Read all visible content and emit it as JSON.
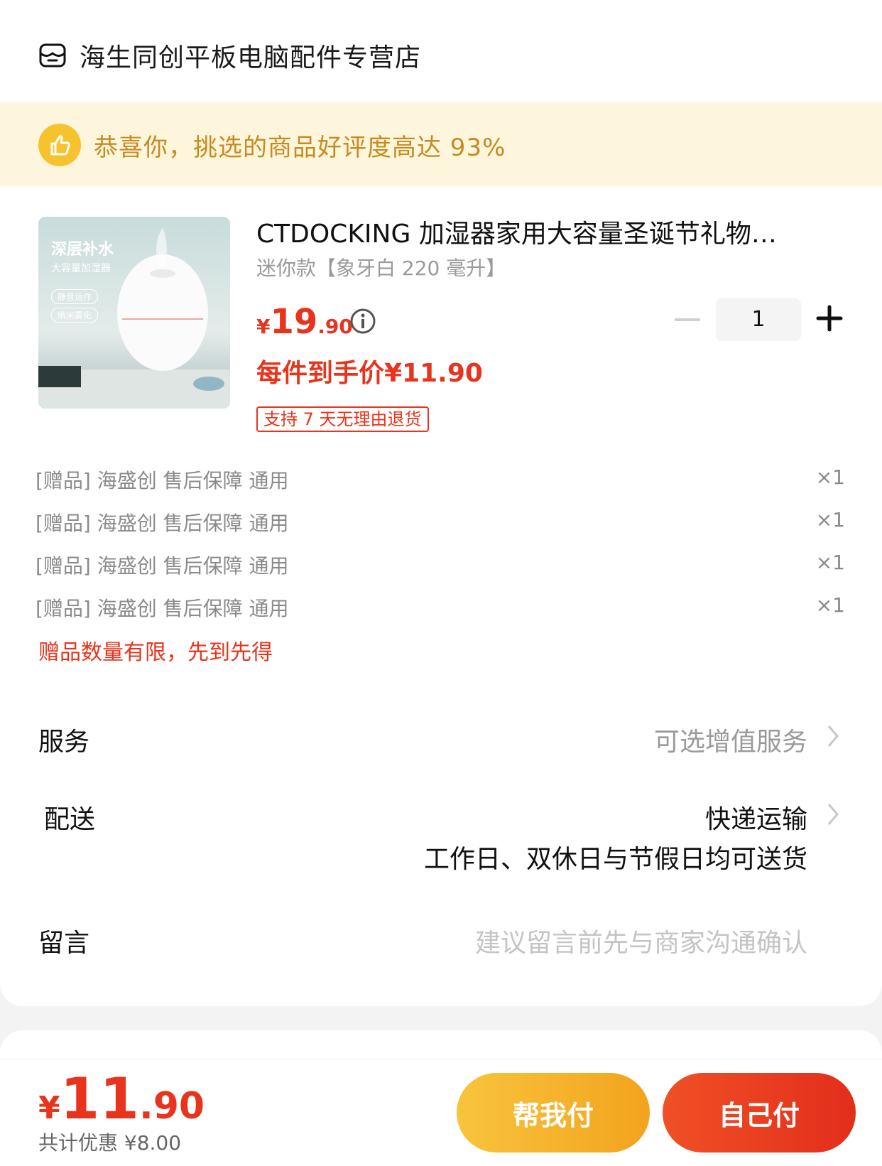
{
  "shop": {
    "name": "海生同创平板电脑配件专营店"
  },
  "banner": {
    "text": "恭喜你，挑选的商品好评度高达 93%"
  },
  "product": {
    "image_text": {
      "line1": "深层补水",
      "line2": "大容量加湿器",
      "tag1": "静音运作",
      "tag2": "纳米雾化"
    },
    "title": "CTDOCKING 加湿器家用大容量圣诞节礼物…",
    "variant": "迷你款【象牙白 220 毫升】",
    "price": {
      "yen": "¥",
      "int": "19",
      "dec": ".90"
    },
    "quantity": "1",
    "per_price": "每件到手价¥11.90",
    "return_tag": "支持 7 天无理由退货"
  },
  "gifts": [
    {
      "label": "[赠品] 海盛创 售后保障 通用",
      "qty": "×1"
    },
    {
      "label": "[赠品] 海盛创 售后保障 通用",
      "qty": "×1"
    },
    {
      "label": "[赠品] 海盛创 售后保障 通用",
      "qty": "×1"
    },
    {
      "label": "[赠品] 海盛创 售后保障 通用",
      "qty": "×1"
    }
  ],
  "gift_note": "赠品数量有限，先到先得",
  "service": {
    "label": "服务",
    "value": "可选增值服务"
  },
  "delivery": {
    "label": "配送",
    "value": "快递运输",
    "note": "工作日、双休日与节假日均可送货"
  },
  "message": {
    "label": "留言",
    "placeholder": "建议留言前先与商家沟通确认"
  },
  "footer": {
    "total": {
      "yen": "¥",
      "int": "11",
      "dec": ".90"
    },
    "discount": "共计优惠 ¥8.00",
    "help_pay": "帮我付",
    "self_pay": "自己付"
  },
  "colors": {
    "accent_red": "#e8341c",
    "banner_bg": "#fdf6dd",
    "banner_text": "#c88a1e",
    "help_btn": "#f5b62a",
    "self_btn": "#e83a1e"
  }
}
